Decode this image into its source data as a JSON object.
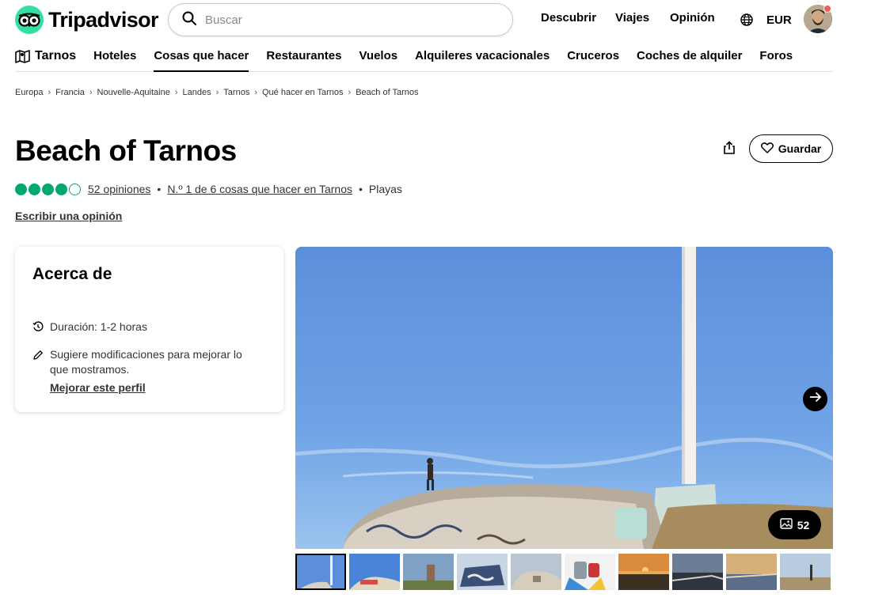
{
  "header": {
    "brand": "Tripadvisor",
    "search_placeholder": "Buscar",
    "nav": [
      "Descubrir",
      "Viajes",
      "Opinión"
    ],
    "currency": "EUR"
  },
  "categories": {
    "home": "Tarnos",
    "items": [
      "Hoteles",
      "Cosas que hacer",
      "Restaurantes",
      "Vuelos",
      "Alquileres vacacionales",
      "Cruceros",
      "Coches de alquiler",
      "Foros"
    ],
    "active": "Cosas que hacer"
  },
  "breadcrumb": [
    "Europa",
    "Francia",
    "Nouvelle-Aquitaine",
    "Landes",
    "Tarnos",
    "Qué hacer en Tarnos",
    "Beach of Tarnos"
  ],
  "title": "Beach of Tarnos",
  "actions": {
    "save_label": "Guardar"
  },
  "rating": {
    "bubbles": 4,
    "reviews_label": "52 opiniones",
    "rank_label": "N.º 1 de 6 cosas que hacer en Tarnos",
    "category": "Playas"
  },
  "write_review": "Escribir una opinión",
  "about": {
    "title": "Acerca de",
    "duration": "Duración: 1-2 horas",
    "suggest": "Sugiere modificaciones para mejorar lo que mostramos.",
    "improve_link": "Mejorar este perfil"
  },
  "gallery": {
    "photo_count": "52",
    "thumbnail_count": 10
  },
  "colors": {
    "brand_green": "#34e0a1",
    "rating_green": "#00aa6c",
    "sky_blue": "#5d93dd"
  }
}
